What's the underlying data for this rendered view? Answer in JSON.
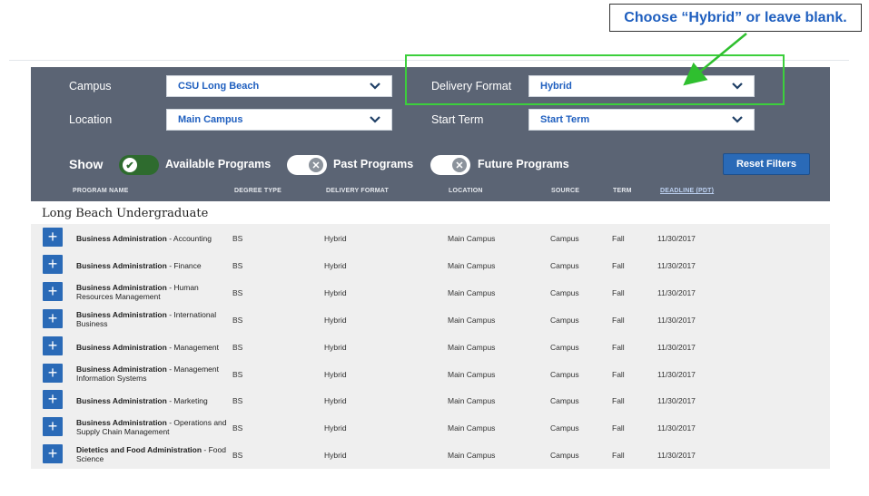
{
  "callout": {
    "text": "Choose “Hybrid” or leave blank."
  },
  "filters": {
    "campus_label": "Campus",
    "campus_value": "CSU Long Beach",
    "location_label": "Location",
    "location_value": "Main Campus",
    "delivery_label": "Delivery Format",
    "delivery_value": "Hybrid",
    "start_term_label": "Start Term",
    "start_term_value": "Start Term",
    "show_label": "Show",
    "toggles": [
      {
        "label": "Available Programs",
        "on": true
      },
      {
        "label": "Past Programs",
        "on": false
      },
      {
        "label": "Future Programs",
        "on": false
      }
    ],
    "reset_label": "Reset Filters"
  },
  "columns": [
    "PROGRAM NAME",
    "DEGREE TYPE",
    "DELIVERY FORMAT",
    "LOCATION",
    "SOURCE",
    "TERM",
    "DEADLINE (PDT)"
  ],
  "section_title": "Long Beach Undergraduate",
  "rows": [
    {
      "name_bold": "Business Administration",
      "name_rest": " - Accounting",
      "degree": "BS",
      "format": "Hybrid",
      "location": "Main Campus",
      "source": "Campus",
      "term": "Fall",
      "deadline": "11/30/2017"
    },
    {
      "name_bold": "Business Administration",
      "name_rest": " - Finance",
      "degree": "BS",
      "format": "Hybrid",
      "location": "Main Campus",
      "source": "Campus",
      "term": "Fall",
      "deadline": "11/30/2017"
    },
    {
      "name_bold": "Business Administration",
      "name_rest": " - Human Resources Management",
      "degree": "BS",
      "format": "Hybrid",
      "location": "Main Campus",
      "source": "Campus",
      "term": "Fall",
      "deadline": "11/30/2017"
    },
    {
      "name_bold": "Business Administration",
      "name_rest": " - International Business",
      "degree": "BS",
      "format": "Hybrid",
      "location": "Main Campus",
      "source": "Campus",
      "term": "Fall",
      "deadline": "11/30/2017"
    },
    {
      "name_bold": "Business Administration",
      "name_rest": " - Management",
      "degree": "BS",
      "format": "Hybrid",
      "location": "Main Campus",
      "source": "Campus",
      "term": "Fall",
      "deadline": "11/30/2017"
    },
    {
      "name_bold": "Business Administration",
      "name_rest": " - Management Information Systems",
      "degree": "BS",
      "format": "Hybrid",
      "location": "Main Campus",
      "source": "Campus",
      "term": "Fall",
      "deadline": "11/30/2017"
    },
    {
      "name_bold": "Business Administration",
      "name_rest": " - Marketing",
      "degree": "BS",
      "format": "Hybrid",
      "location": "Main Campus",
      "source": "Campus",
      "term": "Fall",
      "deadline": "11/30/2017"
    },
    {
      "name_bold": "Business Administration",
      "name_rest": " - Operations and Supply Chain Management",
      "degree": "BS",
      "format": "Hybrid",
      "location": "Main Campus",
      "source": "Campus",
      "term": "Fall",
      "deadline": "11/30/2017"
    },
    {
      "name_bold": "Dietetics and Food Administration",
      "name_rest": " - Food Science",
      "degree": "BS",
      "format": "Hybrid",
      "location": "Main Campus",
      "source": "Campus",
      "term": "Fall",
      "deadline": "11/30/2017"
    }
  ],
  "colors": {
    "panel": "#5b6474",
    "accent": "#2a6ab7",
    "toggle_on": "#2e6b2e",
    "highlight": "#3ccf3c"
  }
}
